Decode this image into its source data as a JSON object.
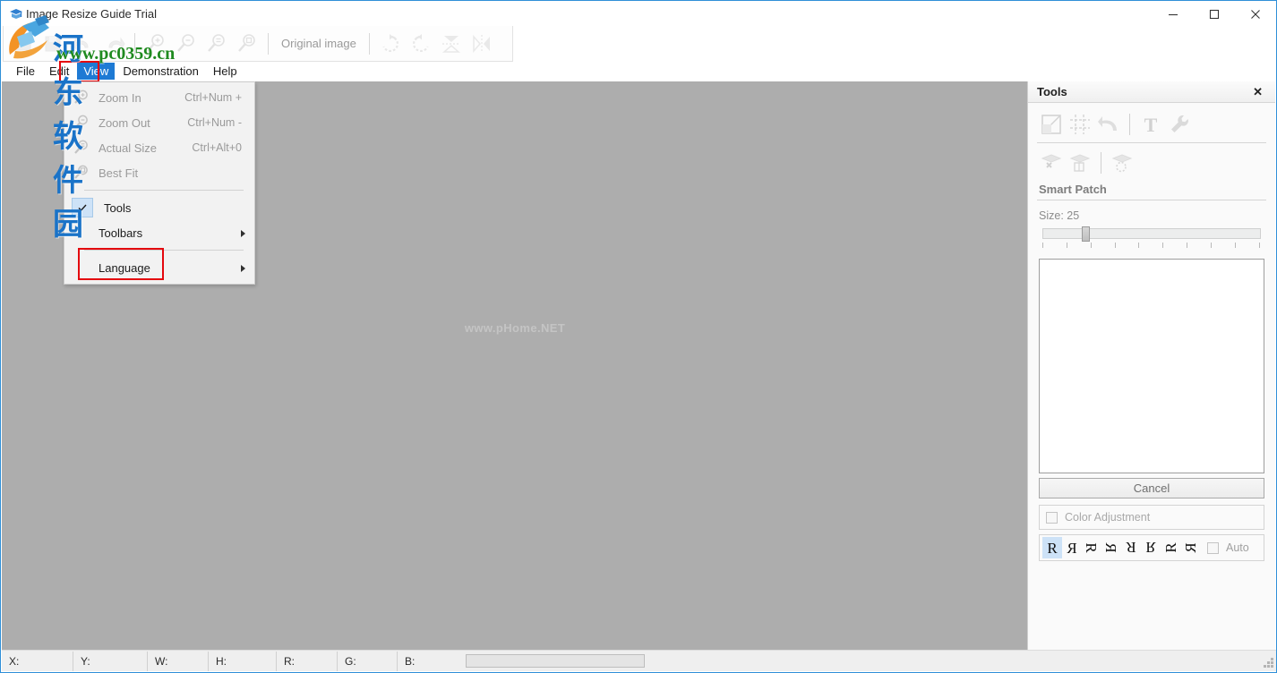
{
  "window": {
    "title": "Image Resize Guide Trial",
    "icon": "app-icon",
    "minimize": "—",
    "maximize": "□",
    "close": "✕"
  },
  "toolbar": {
    "buttons": [
      {
        "name": "open-icon",
        "label": ""
      },
      {
        "name": "save-icon",
        "label": ""
      },
      {
        "name": "undo-icon",
        "label": ""
      },
      {
        "name": "redo-icon",
        "label": ""
      },
      {
        "name": "zoom-in-icon",
        "label": ""
      },
      {
        "name": "zoom-out-icon",
        "label": ""
      },
      {
        "name": "actual-size-icon",
        "label": ""
      },
      {
        "name": "best-fit-icon",
        "label": ""
      }
    ],
    "original_image_label": "Original image",
    "rotate_cw": "rotate-cw-icon",
    "rotate_ccw": "rotate-ccw-icon",
    "flip_vertical": "flip-vertical-icon",
    "flip_horizontal": "flip-horizontal-icon"
  },
  "menubar": {
    "items": [
      {
        "label": "File",
        "active": false
      },
      {
        "label": "Edit",
        "active": false
      },
      {
        "label": "View",
        "active": true
      },
      {
        "label": "Demonstration",
        "active": false
      },
      {
        "label": "Help",
        "active": false
      }
    ]
  },
  "view_menu": {
    "items": [
      {
        "label": "Zoom In",
        "shortcut": "Ctrl+Num +",
        "icon": "zoom-in-icon",
        "disabled": true,
        "checked": false,
        "submenu": false
      },
      {
        "label": "Zoom Out",
        "shortcut": "Ctrl+Num -",
        "icon": "zoom-out-icon",
        "disabled": true,
        "checked": false,
        "submenu": false
      },
      {
        "label": "Actual Size",
        "shortcut": "Ctrl+Alt+0",
        "icon": "actual-size-icon",
        "disabled": true,
        "checked": false,
        "submenu": false
      },
      {
        "label": "Best Fit",
        "shortcut": "",
        "icon": "best-fit-icon",
        "disabled": true,
        "checked": false,
        "submenu": false
      },
      {
        "label": "Tools",
        "shortcut": "",
        "icon": "",
        "disabled": false,
        "checked": true,
        "submenu": false
      },
      {
        "label": "Toolbars",
        "shortcut": "",
        "icon": "",
        "disabled": false,
        "checked": false,
        "submenu": true
      },
      {
        "label": "Language",
        "shortcut": "",
        "icon": "",
        "disabled": false,
        "checked": false,
        "submenu": true
      }
    ]
  },
  "canvas": {
    "watermark": "www.pHome.NET",
    "background_color": "#adadad"
  },
  "tools_panel": {
    "title": "Tools",
    "close_label": "✕",
    "row1_icons": [
      "resize-icon",
      "crop-grid-icon",
      "undo-arrow-icon",
      "text-tool-icon",
      "wrench-icon"
    ],
    "row2_icons": [
      "remove-object-icon",
      "patch-object-icon",
      "smart-patch-icon"
    ],
    "section_title": "Smart Patch",
    "size_label": "Size: 25",
    "size_value": 25,
    "cancel_label": "Cancel",
    "color_adjustment_label": "Color Adjustment",
    "color_adjustment_checked": false,
    "orientations": [
      "R",
      "R-flip-h",
      "R-rot270",
      "R-rot90-flip",
      "R-rot180",
      "R-rot90",
      "R-rot270-flip",
      "R-rot180-flip"
    ],
    "selected_orientation_index": 0,
    "auto_label": "Auto",
    "auto_checked": false
  },
  "statusbar": {
    "fields": [
      {
        "label": "X:",
        "value": ""
      },
      {
        "label": "Y:",
        "value": ""
      },
      {
        "label": "W:",
        "value": ""
      },
      {
        "label": "H:",
        "value": ""
      },
      {
        "label": "R:",
        "value": ""
      },
      {
        "label": "G:",
        "value": ""
      },
      {
        "label": "B:",
        "value": ""
      }
    ],
    "progress": 0
  },
  "site_watermark": {
    "chinese": "河东软件园",
    "url": "www.pc0359.cn"
  },
  "colors": {
    "accent": "#1e7ad4",
    "highlight_box": "#e4070e",
    "canvas": "#adadad",
    "panel": "#fafafa"
  }
}
